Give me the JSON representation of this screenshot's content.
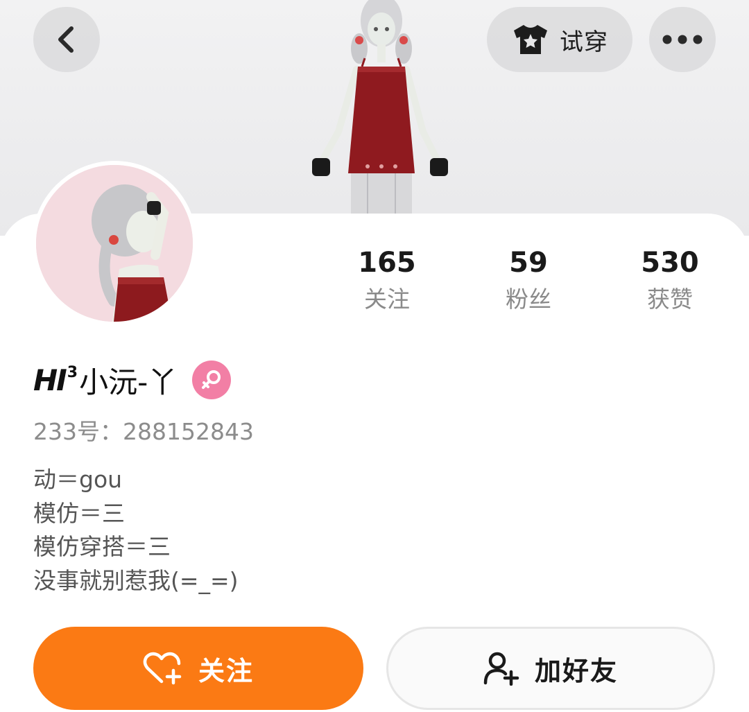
{
  "header": {
    "back_icon": "chevron-left-icon",
    "try_on_label": "试穿",
    "try_on_icon": "tshirt-star-icon",
    "more_icon": "more-dots-icon"
  },
  "profile": {
    "name_prefix": "HI",
    "name_prefix_superscript": "3",
    "name": "小沅-丫",
    "gender": "female",
    "gender_icon": "female-icon",
    "gender_color": "#f27fa5",
    "id_line": "233号：288152843",
    "bio": [
      "动＝gou",
      "模仿＝三",
      "模仿穿搭＝三",
      "没事就别惹我(=_=)"
    ]
  },
  "stats": [
    {
      "value": "165",
      "label": "关注"
    },
    {
      "value": "59",
      "label": "粉丝"
    },
    {
      "value": "530",
      "label": "获赞"
    }
  ],
  "actions": {
    "follow_label": "关注",
    "follow_icon": "heart-plus-icon",
    "follow_color": "#fb7a14",
    "add_friend_label": "加好友",
    "add_friend_icon": "add-user-icon"
  }
}
